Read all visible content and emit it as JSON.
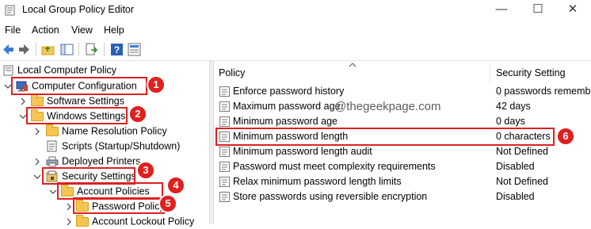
{
  "window": {
    "title": "Local Group Policy Editor",
    "controls": [
      "—",
      "☐",
      "✕"
    ]
  },
  "menu": {
    "items": [
      "File",
      "Action",
      "View",
      "Help"
    ]
  },
  "tree": {
    "nodes": [
      {
        "label": "Local Computer Policy"
      },
      {
        "label": "Computer Configuration"
      },
      {
        "label": "Software Settings"
      },
      {
        "label": "Windows Settings"
      },
      {
        "label": "Name Resolution Policy"
      },
      {
        "label": "Scripts (Startup/Shutdown)"
      },
      {
        "label": "Deployed Printers"
      },
      {
        "label": "Security Settings"
      },
      {
        "label": "Account Policies"
      },
      {
        "label": "Password Policy"
      },
      {
        "label": "Account Lockout Policy"
      }
    ]
  },
  "list": {
    "columns": {
      "policy": "Policy",
      "setting": "Security Setting"
    },
    "rows": [
      {
        "policy": "Enforce password history",
        "setting": "0 passwords remembe"
      },
      {
        "policy": "Maximum password age",
        "setting": "42 days"
      },
      {
        "policy": "Minimum password age",
        "setting": "0 days"
      },
      {
        "policy": "Minimum password length",
        "setting": "0 characters"
      },
      {
        "policy": "Minimum password length audit",
        "setting": "Not Defined"
      },
      {
        "policy": "Password must meet complexity requirements",
        "setting": "Disabled"
      },
      {
        "policy": "Relax minimum password length limits",
        "setting": "Not Defined"
      },
      {
        "policy": "Store passwords using reversible encryption",
        "setting": "Disabled"
      }
    ]
  },
  "watermark": "@thegeekpage.com",
  "annotations": [
    "1",
    "2",
    "3",
    "4",
    "5",
    "6"
  ],
  "colors": {
    "annotation": "#e01f1f",
    "folder": "#f4c553"
  }
}
